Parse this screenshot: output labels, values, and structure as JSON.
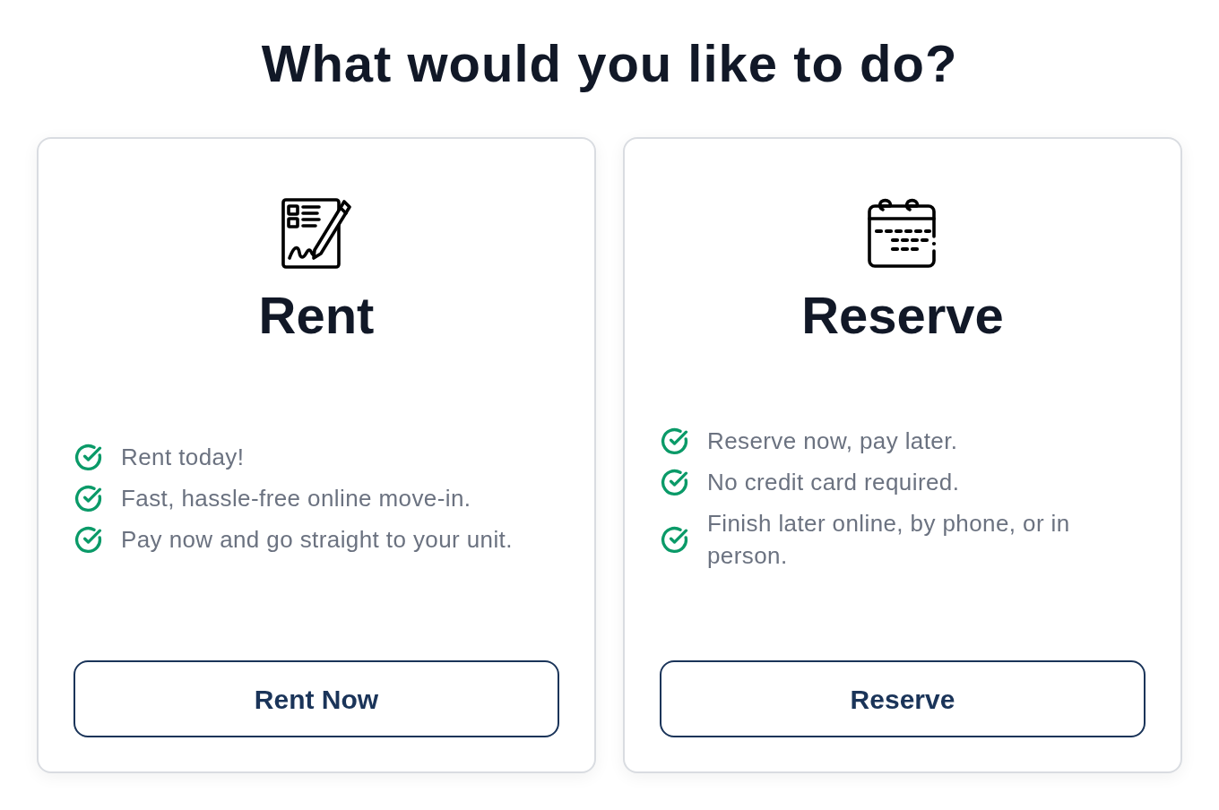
{
  "heading": "What would you like to do?",
  "options": [
    {
      "kind": "rent",
      "title": "Rent",
      "features": [
        "Rent today!",
        "Fast, hassle-free online move-in.",
        "Pay now and go straight to your unit."
      ],
      "button": "Rent Now"
    },
    {
      "kind": "reserve",
      "title": "Reserve",
      "features": [
        "Reserve now, pay later.",
        "No credit card required.",
        "Finish later online, by phone, or in person."
      ],
      "button": "Reserve"
    }
  ]
}
